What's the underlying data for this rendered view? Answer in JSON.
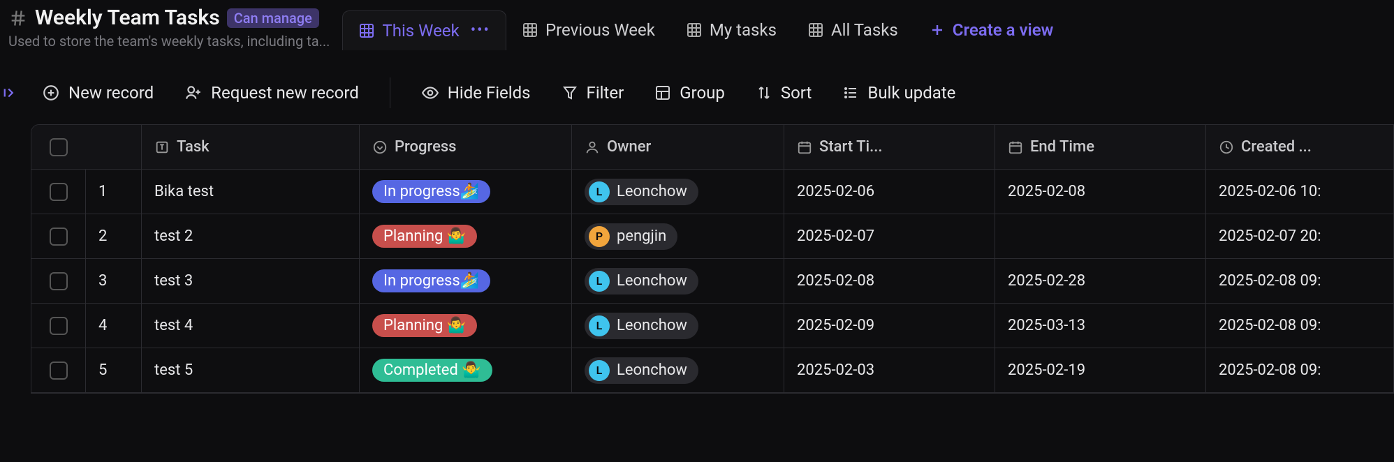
{
  "header": {
    "title": "Weekly Team Tasks",
    "permission_label": "Can manage",
    "subtitle": "Used to store the team's weekly tasks, including ta..."
  },
  "views": {
    "items": [
      {
        "label": "This Week",
        "active": true
      },
      {
        "label": "Previous Week",
        "active": false
      },
      {
        "label": "My tasks",
        "active": false
      },
      {
        "label": "All Tasks",
        "active": false
      }
    ],
    "create_label": "Create a view"
  },
  "toolbar": {
    "new_record_label": "New record",
    "request_new_record_label": "Request new record",
    "hide_fields_label": "Hide Fields",
    "filter_label": "Filter",
    "group_label": "Group",
    "sort_label": "Sort",
    "bulk_update_label": "Bulk update"
  },
  "columns": {
    "task": "Task",
    "progress": "Progress",
    "owner": "Owner",
    "start_time": "Start Ti...",
    "end_time": "End Time",
    "created": "Created ..."
  },
  "progress_styles": {
    "In progress🏄": "prog-inprogress",
    "Planning 🤷‍♂️": "prog-planning",
    "Completed 🤷‍♂️": "prog-completed"
  },
  "owner_styles": {
    "Leonchow": {
      "initial": "L",
      "avatar_class": "av-blue"
    },
    "pengjin": {
      "initial": "P",
      "avatar_class": "av-orange"
    }
  },
  "rows": [
    {
      "idx": "1",
      "task": "Bika test",
      "progress": "In progress🏄",
      "owner": "Leonchow",
      "start": "2025-02-06",
      "end": "2025-02-08",
      "created": "2025-02-06 10:"
    },
    {
      "idx": "2",
      "task": "test 2",
      "progress": "Planning 🤷‍♂️",
      "owner": "pengjin",
      "start": "2025-02-07",
      "end": "",
      "created": "2025-02-07 20:"
    },
    {
      "idx": "3",
      "task": "test 3",
      "progress": "In progress🏄",
      "owner": "Leonchow",
      "start": "2025-02-08",
      "end": "2025-02-28",
      "created": "2025-02-08 09:"
    },
    {
      "idx": "4",
      "task": "test 4",
      "progress": "Planning 🤷‍♂️",
      "owner": "Leonchow",
      "start": "2025-02-09",
      "end": "2025-03-13",
      "created": "2025-02-08 09:"
    },
    {
      "idx": "5",
      "task": "test 5",
      "progress": "Completed 🤷‍♂️",
      "owner": "Leonchow",
      "start": "2025-02-03",
      "end": "2025-02-19",
      "created": "2025-02-08 09:"
    }
  ]
}
